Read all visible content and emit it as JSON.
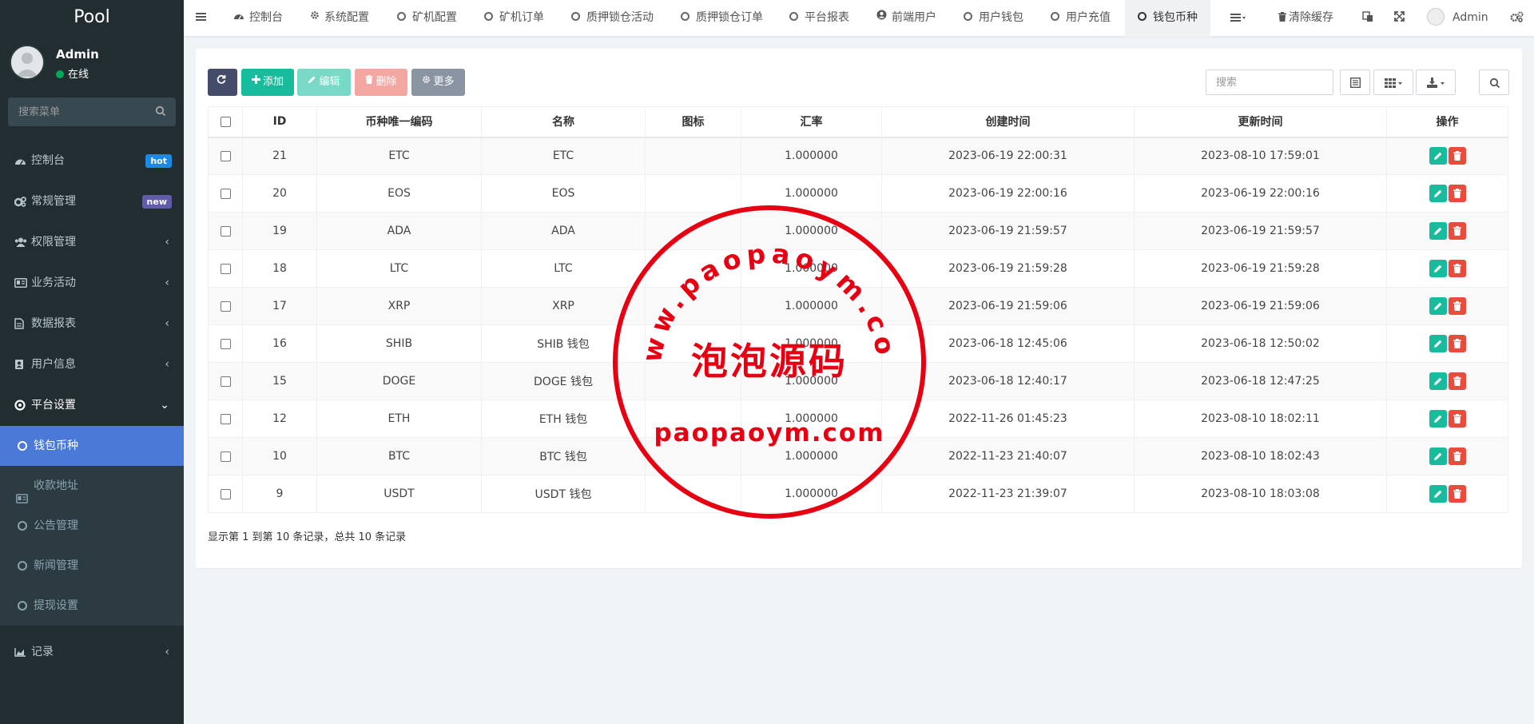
{
  "app": {
    "logo": "Pool"
  },
  "user": {
    "name": "Admin",
    "status": "在线"
  },
  "sidebar": {
    "search_placeholder": "搜索菜单",
    "items": [
      {
        "label": "控制台",
        "badge": "hot",
        "icon": "dashboard-icon"
      },
      {
        "label": "常规管理",
        "badge": "new",
        "icon": "cogs-icon"
      },
      {
        "label": "权限管理",
        "icon": "users-icon"
      },
      {
        "label": "业务活动",
        "icon": "id-card-icon"
      },
      {
        "label": "数据报表",
        "icon": "file-icon"
      },
      {
        "label": "用户信息",
        "icon": "address-book-icon"
      },
      {
        "label": "平台设置",
        "icon": "life-ring-icon"
      }
    ],
    "sub_items": [
      {
        "label": "钱包币种"
      },
      {
        "label": "收款地址"
      },
      {
        "label": "公告管理"
      },
      {
        "label": "新闻管理"
      },
      {
        "label": "提现设置"
      }
    ],
    "last_item": {
      "label": "记录",
      "icon": "area-chart-icon"
    }
  },
  "topnav": {
    "tabs": [
      {
        "label": "控制台"
      },
      {
        "label": "系统配置"
      },
      {
        "label": "矿机配置"
      },
      {
        "label": "矿机订单"
      },
      {
        "label": "质押锁仓活动"
      },
      {
        "label": "质押锁仓订单"
      },
      {
        "label": "平台报表"
      },
      {
        "label": "前端用户"
      },
      {
        "label": "用户钱包"
      },
      {
        "label": "用户充值"
      },
      {
        "label": "钱包币种"
      }
    ],
    "clear_cache": "清除缓存",
    "admin": "Admin"
  },
  "toolbar": {
    "add": "添加",
    "edit": "编辑",
    "delete": "删除",
    "more": "更多",
    "search_placeholder": "搜索"
  },
  "table": {
    "headers": [
      "ID",
      "币种唯一编码",
      "名称",
      "图标",
      "汇率",
      "创建时间",
      "更新时间",
      "操作"
    ],
    "rows": [
      {
        "id": "21",
        "code": "ETC",
        "name": "ETC",
        "icon": "",
        "rate": "1.000000",
        "created": "2023-06-19 22:00:31",
        "updated": "2023-08-10 17:59:01"
      },
      {
        "id": "20",
        "code": "EOS",
        "name": "EOS",
        "icon": "",
        "rate": "1.000000",
        "created": "2023-06-19 22:00:16",
        "updated": "2023-06-19 22:00:16"
      },
      {
        "id": "19",
        "code": "ADA",
        "name": "ADA",
        "icon": "",
        "rate": "1.000000",
        "created": "2023-06-19 21:59:57",
        "updated": "2023-06-19 21:59:57"
      },
      {
        "id": "18",
        "code": "LTC",
        "name": "LTC",
        "icon": "",
        "rate": "1.000000",
        "created": "2023-06-19 21:59:28",
        "updated": "2023-06-19 21:59:28"
      },
      {
        "id": "17",
        "code": "XRP",
        "name": "XRP",
        "icon": "",
        "rate": "1.000000",
        "created": "2023-06-19 21:59:06",
        "updated": "2023-06-19 21:59:06"
      },
      {
        "id": "16",
        "code": "SHIB",
        "name": "SHIB 钱包",
        "icon": "",
        "rate": "1.000000",
        "created": "2023-06-18 12:45:06",
        "updated": "2023-06-18 12:50:02"
      },
      {
        "id": "15",
        "code": "DOGE",
        "name": "DOGE 钱包",
        "icon": "",
        "rate": "1.000000",
        "created": "2023-06-18 12:40:17",
        "updated": "2023-06-18 12:47:25"
      },
      {
        "id": "12",
        "code": "ETH",
        "name": "ETH 钱包",
        "icon": "",
        "rate": "1.000000",
        "created": "2022-11-26 01:45:23",
        "updated": "2023-08-10 18:02:11"
      },
      {
        "id": "10",
        "code": "BTC",
        "name": "BTC 钱包",
        "icon": "",
        "rate": "1.000000",
        "created": "2022-11-23 21:40:07",
        "updated": "2023-08-10 18:02:43"
      },
      {
        "id": "9",
        "code": "USDT",
        "name": "USDT 钱包",
        "icon": "",
        "rate": "1.000000",
        "created": "2022-11-23 21:39:07",
        "updated": "2023-08-10 18:03:08"
      }
    ]
  },
  "pagination": {
    "info": "显示第 1 到第 10 条记录，总共 10 条记录"
  },
  "watermark": {
    "top_arc": "www.paopaoym.com",
    "center": "泡泡源码",
    "bottom": "paopaoym.com",
    "color": "#e60012"
  }
}
